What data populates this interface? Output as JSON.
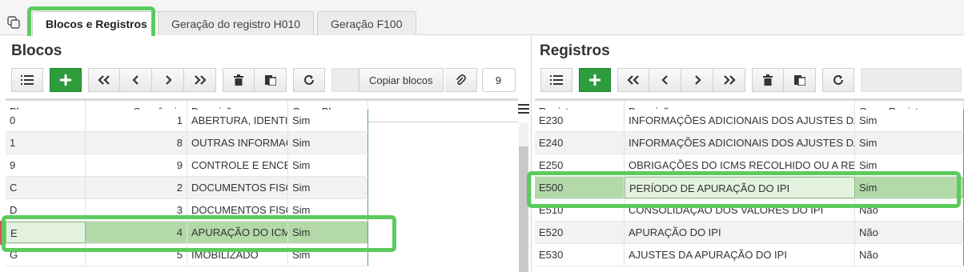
{
  "tabs": [
    {
      "label": "Blocos e Registros",
      "active": true
    },
    {
      "label": "Geração do registro H010",
      "active": false
    },
    {
      "label": "Geração F100",
      "active": false
    }
  ],
  "left": {
    "title": "Blocos",
    "copy_label": "Copiar blocos",
    "count": "9",
    "columns": [
      "Bloco",
      "Sequência",
      "Descrição",
      "Gerar Bloco"
    ],
    "rows": [
      {
        "bloco": "0",
        "seq": "1",
        "desc": "ABERTURA, IDENTIFICAÇÃO",
        "gerar": "Sim"
      },
      {
        "bloco": "1",
        "seq": "8",
        "desc": "OUTRAS INFORMAÇÕES",
        "gerar": "Sim"
      },
      {
        "bloco": "9",
        "seq": "9",
        "desc": "CONTROLE E ENCERRAMENTO",
        "gerar": "Sim"
      },
      {
        "bloco": "C",
        "seq": "2",
        "desc": "DOCUMENTOS FISCAIS I",
        "gerar": "Sim"
      },
      {
        "bloco": "D",
        "seq": "3",
        "desc": "DOCUMENTOS FISCAIS II",
        "gerar": "Sim"
      },
      {
        "bloco": "E",
        "seq": "4",
        "desc": "APURAÇÃO DO ICMS E DO IPI",
        "gerar": "Sim"
      },
      {
        "bloco": "G",
        "seq": "5",
        "desc": "IMOBILIZADO",
        "gerar": "Sim"
      }
    ]
  },
  "right": {
    "title": "Registros",
    "columns": [
      "Registro",
      "Descrição",
      "Gerar Registro"
    ],
    "rows": [
      {
        "reg": "E230",
        "desc": "INFORMAÇÕES ADICIONAIS DOS AJUSTES DA APURAÇÃO",
        "gerar": "Sim"
      },
      {
        "reg": "E240",
        "desc": "INFORMAÇÕES ADICIONAIS DOS AJUSTES DA APURAÇÃO",
        "gerar": "Sim"
      },
      {
        "reg": "E250",
        "desc": "OBRIGAÇÕES DO ICMS RECOLHIDO OU A RECOLHER",
        "gerar": "Sim"
      },
      {
        "reg": "E500",
        "desc": "PERÍODO DE APURAÇÃO DO IPI",
        "gerar": "Sim"
      },
      {
        "reg": "E510",
        "desc": "CONSOLIDAÇÃO DOS VALORES DO IPI",
        "gerar": "Não"
      },
      {
        "reg": "E520",
        "desc": "APURAÇÃO DO IPI",
        "gerar": "Não"
      },
      {
        "reg": "E530",
        "desc": "AJUSTES DA APURAÇÃO DO IPI",
        "gerar": "Não"
      }
    ]
  },
  "selected": {
    "left_row": 5,
    "right_row": 3
  },
  "colors": {
    "accent": "#2e9e3d",
    "highlight": "#5ccb5f",
    "selected_row": "#b3d9a9"
  }
}
